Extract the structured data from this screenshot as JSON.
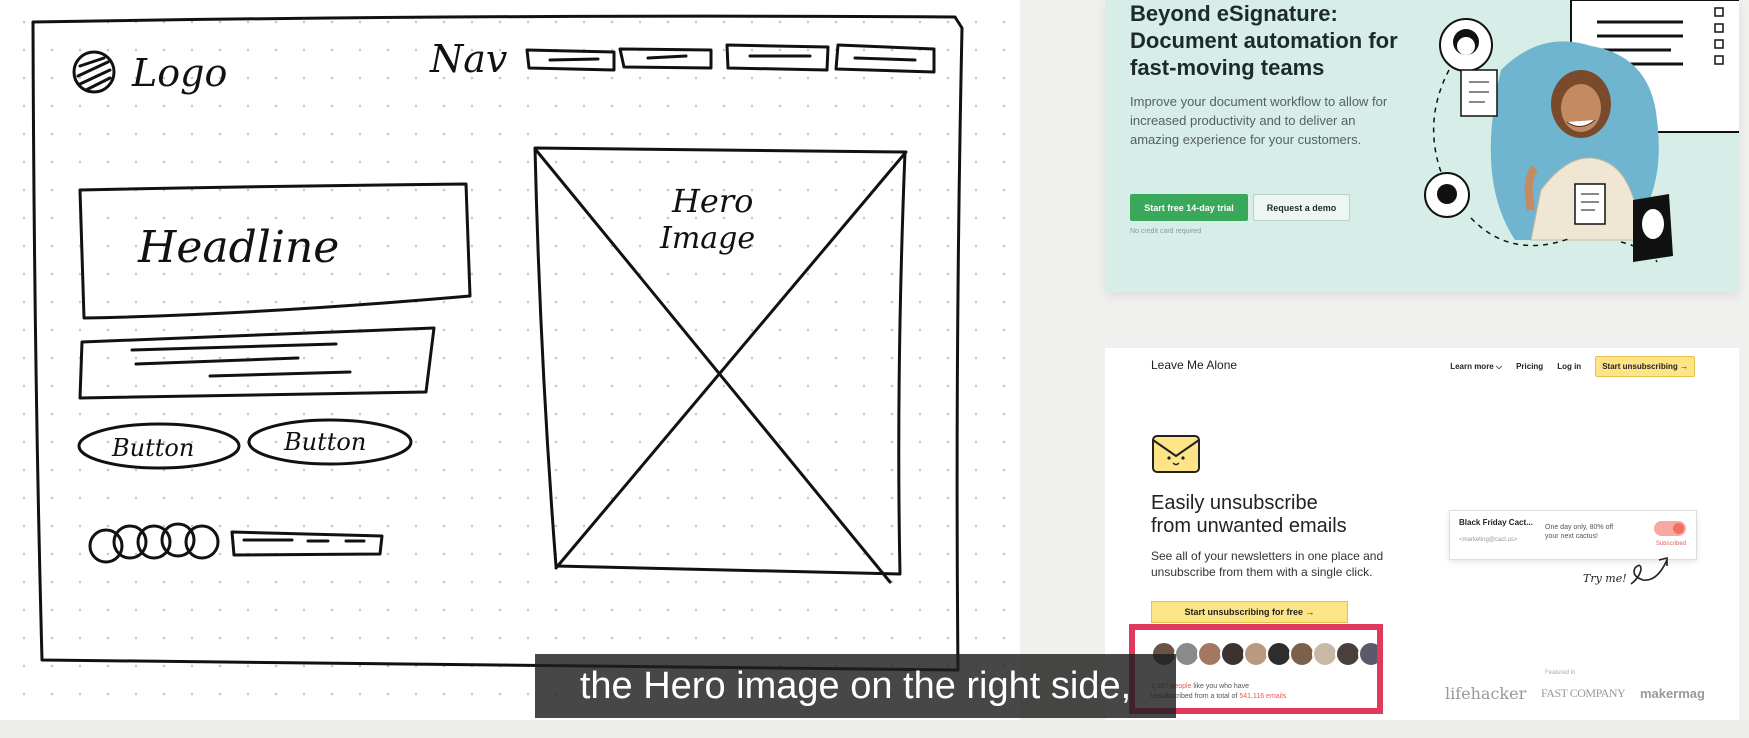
{
  "sketch": {
    "logo": "Logo",
    "nav": "Nav",
    "hero": [
      "Hero",
      "Image"
    ],
    "headline": "Headline",
    "buttons": [
      "Button",
      "Button"
    ]
  },
  "esignature": {
    "headline": "Beyond eSignature: Document automation for fast-moving teams",
    "description": "Improve your document workflow to allow for increased productivity and to deliver an amazing experience for your customers.",
    "primary_button": "Start free 14-day trial",
    "secondary_button": "Request a demo",
    "note": "No credit card required",
    "colors": {
      "background": "#d7eee8",
      "primary": "#3aa85a"
    }
  },
  "leave_me_alone": {
    "brand": "Leave Me Alone",
    "nav": {
      "learn_more": "Learn more",
      "pricing": "Pricing",
      "login": "Log in",
      "cta": "Start unsubscribing →"
    },
    "headline_line1": "Easily unsubscribe",
    "headline_line2": "from unwanted emails",
    "subtext": "See all of your newsletters in one place and unsubscribe from them with a single click.",
    "start_button": "Start unsubscribing for free →",
    "stats": {
      "count": "1,967 people",
      "line1_rest": " like you who have",
      "line2_start": "unsubscribed from a total of ",
      "emails": "541,116 emails"
    },
    "demo_card": {
      "sender": "Black Friday Cact...",
      "email": "<marketing@cact.us>",
      "description": "One day only, 80% off your next cactus!",
      "status": "Subscribed"
    },
    "try_me": "Try me!",
    "featured_label": "Featured in",
    "featured_logos": [
      "lifehacker",
      "FAST COMPANY",
      "makermag"
    ],
    "colors": {
      "accent": "#fde587",
      "highlight_frame": "#e0395b"
    }
  },
  "caption": "the Hero image on the right side,"
}
